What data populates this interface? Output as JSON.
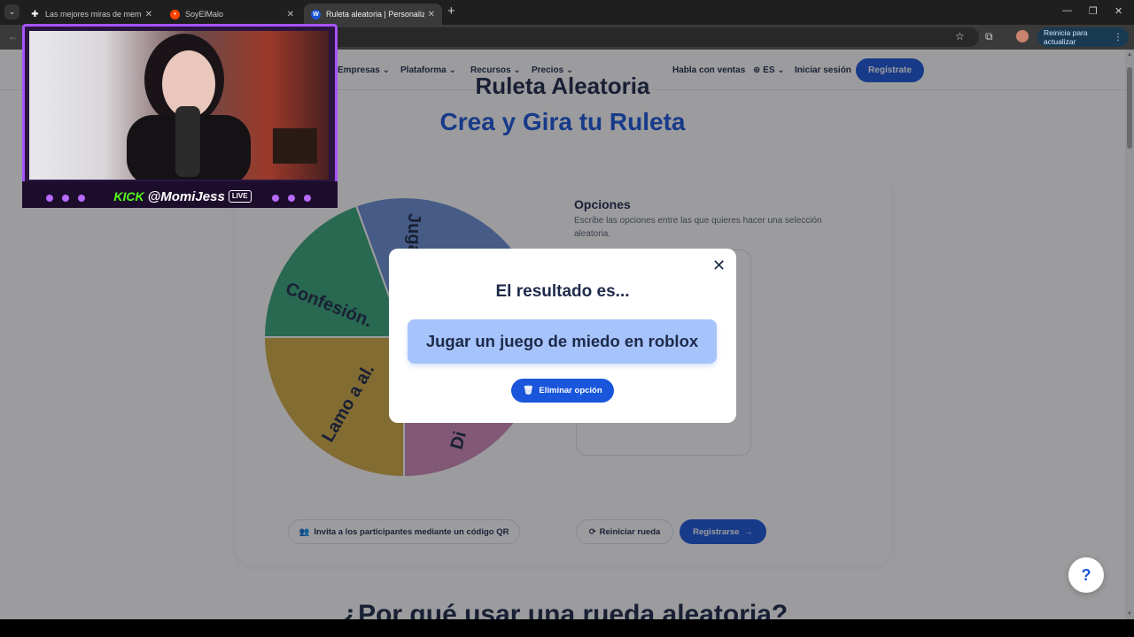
{
  "browser": {
    "tabs": [
      {
        "title": "Las mejores miras de memes d",
        "favicon": "plus-icon",
        "active": false
      },
      {
        "title": "SoyElMalo",
        "favicon": "reddit-icon",
        "active": false
      },
      {
        "title": "Ruleta aleatoria | Personaliza y",
        "favicon": "wheel-logo-icon",
        "active": true
      }
    ],
    "update_label": "Reinicia para actualizar"
  },
  "header": {
    "nav": [
      "Empresas",
      "Plataforma",
      "Recursos",
      "Precios"
    ],
    "sales": "Habla con ventas",
    "lang": "ES",
    "login": "Iniciar sesión",
    "register": "Regístrate"
  },
  "hero": {
    "title": "Ruleta Aleatoria",
    "subtitle": "Crea y Gira tu Ruleta"
  },
  "wheel": {
    "segments": [
      {
        "label": "Juga",
        "color": "#6b8fd6"
      },
      {
        "label": "",
        "color": "#8b6fd6"
      },
      {
        "label": "Confesión.",
        "color": "#3aa57a"
      },
      {
        "label": "Lamo a al.",
        "color": "#d4ad45"
      },
      {
        "label": "Di",
        "color": "#d08ab8"
      }
    ]
  },
  "options": {
    "title": "Opciones",
    "description": "Escribe las opciones entre las que quieres hacer una selección aleatoria."
  },
  "actions": {
    "qr": "Invita a los participantes mediante un código QR",
    "reset": "Reiniciar rueda",
    "signup": "Registrarse"
  },
  "why_title": "¿Por qué usar una rueda aleatoria?",
  "modal": {
    "title": "El resultado es...",
    "result": "Jugar un juego de miedo en roblox",
    "delete": "Eliminar opción"
  },
  "help": "?",
  "stream": {
    "kick": "KICK",
    "handle": "@MomiJess",
    "live": "LIVE"
  },
  "colors": {
    "brand_blue": "#1a56db",
    "navy": "#1e2a4a",
    "result_bg": "#a6c4fb",
    "stream_purple": "#a653ff",
    "kick_green": "#53fc18"
  }
}
